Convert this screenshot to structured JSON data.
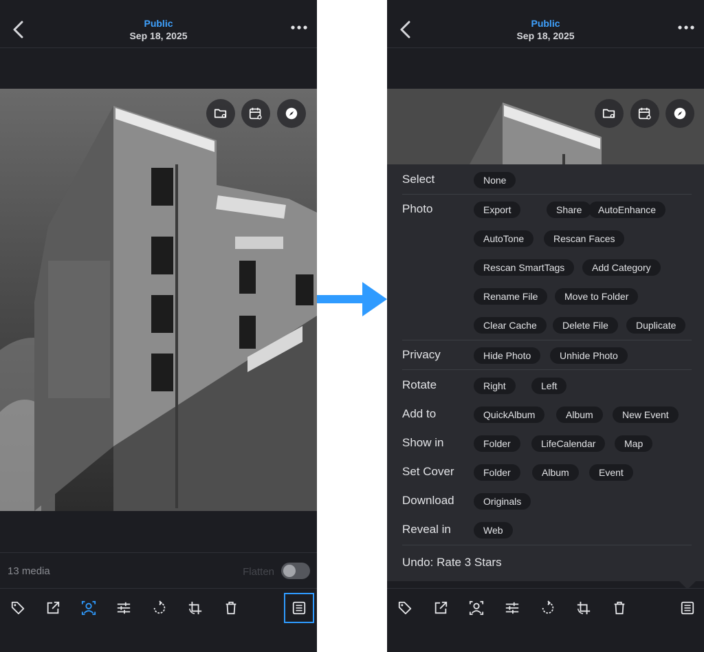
{
  "header": {
    "album": "Public",
    "date": "Sep 18, 2025"
  },
  "footer": {
    "media_count": "13 media",
    "flatten_label": "Flatten",
    "flatten_on": false
  },
  "icons": {
    "back": "chevron-left-icon",
    "more": "more-horizontal-icon",
    "overlays": [
      "folder-eye-icon",
      "calendar-eye-icon",
      "compass-icon"
    ],
    "toolbar": [
      "tag-icon",
      "open-external-icon",
      "face-scan-icon",
      "sliders-icon",
      "rotate-icon",
      "crop-rotate-icon",
      "trash-icon",
      "details-icon"
    ]
  },
  "colors": {
    "accent": "#2f9bff",
    "background": "#1c1d22",
    "menu_background": "#2a2b30",
    "chip_background": "#1a1b1f",
    "arrow": "#2f9bff"
  },
  "menu": {
    "select": {
      "label": "Select",
      "options": [
        "None"
      ]
    },
    "photo": {
      "label": "Photo",
      "options": [
        "Export",
        "Share",
        "AutoEnhance",
        "AutoTone",
        "Rescan Faces",
        "Rescan SmartTags",
        "Add Category",
        "Rename File",
        "Move to Folder",
        "Clear Cache",
        "Delete File",
        "Duplicate"
      ]
    },
    "privacy": {
      "label": "Privacy",
      "options": [
        "Hide Photo",
        "Unhide Photo"
      ]
    },
    "rotate": {
      "label": "Rotate",
      "options": [
        "Right",
        "Left"
      ]
    },
    "add_to": {
      "label": "Add to",
      "options": [
        "QuickAlbum",
        "Album",
        "New Event"
      ]
    },
    "show_in": {
      "label": "Show in",
      "options": [
        "Folder",
        "LifeCalendar",
        "Map"
      ]
    },
    "set_cover": {
      "label": "Set Cover",
      "options": [
        "Folder",
        "Album",
        "Event"
      ]
    },
    "download": {
      "label": "Download",
      "options": [
        "Originals"
      ]
    },
    "reveal_in": {
      "label": "Reveal in",
      "options": [
        "Web"
      ]
    },
    "undo": "Undo: Rate 3 Stars"
  }
}
